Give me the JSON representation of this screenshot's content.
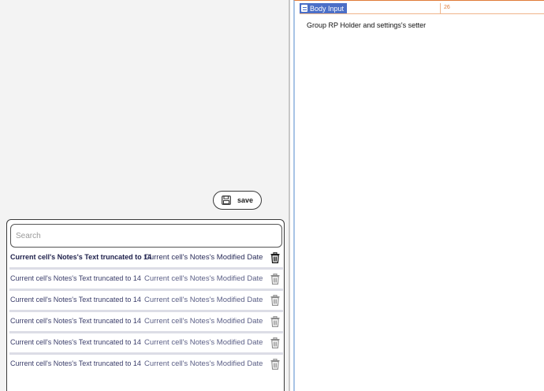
{
  "toolbar": {
    "save_label": "save"
  },
  "search": {
    "placeholder": "Search",
    "value": ""
  },
  "notes": [
    {
      "text": "Current cell's Notes's Text truncated to 14",
      "date": "Current cell's Notes's Modified Date"
    },
    {
      "text": "Current cell's Notes's Text truncated to 14",
      "date": "Current cell's Notes's Modified Date"
    },
    {
      "text": "Current cell's Notes's Text truncated to 14",
      "date": "Current cell's Notes's Modified Date"
    },
    {
      "text": "Current cell's Notes's Text truncated to 14",
      "date": "Current cell's Notes's Modified Date"
    },
    {
      "text": "Current cell's Notes's Text truncated to 14",
      "date": "Current cell's Notes's Modified Date"
    },
    {
      "text": "Current cell's Notes's Text truncated to 14",
      "date": "Current cell's Notes's Modified Date"
    }
  ],
  "right_panel": {
    "tag_label": "Body Input",
    "column_value": "26",
    "group_label": "Group RP Holder and settings's setter"
  },
  "colors": {
    "accent_blue": "#4b6fc7",
    "orange": "#e07b39",
    "note_text": "#3a3d6a"
  },
  "icons": [
    "save-icon",
    "trash-icon",
    "document-icon"
  ]
}
